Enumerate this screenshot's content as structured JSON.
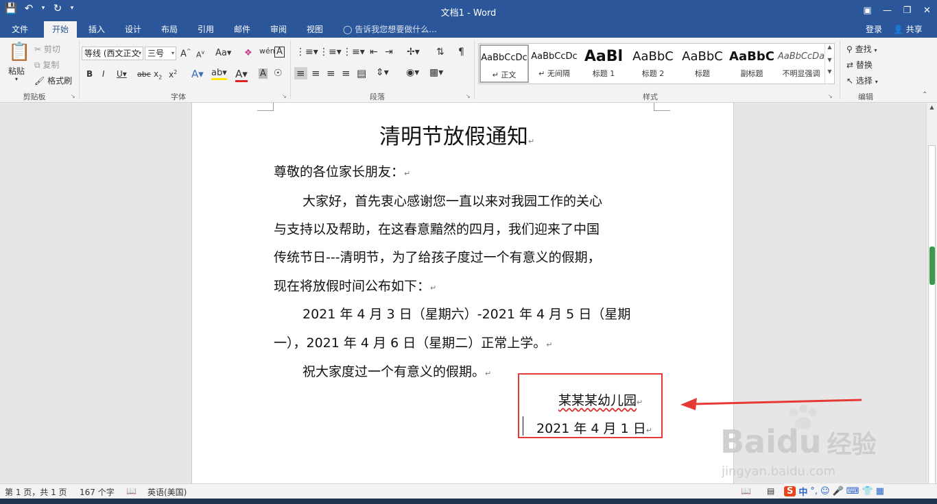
{
  "window": {
    "title": "文档1 - Word"
  },
  "tabs": [
    "文件",
    "开始",
    "插入",
    "设计",
    "布局",
    "引用",
    "邮件",
    "审阅",
    "视图"
  ],
  "tell_me": "告诉我您想要做什么...",
  "account": {
    "signin": "登录",
    "share": "共享"
  },
  "clipboard": {
    "paste": "粘贴",
    "cut": "剪切",
    "copy": "复制",
    "format_painter": "格式刷",
    "group_label": "剪贴板"
  },
  "font": {
    "font_name": "等线 (西文正文",
    "font_size": "三号",
    "group_label": "字体"
  },
  "paragraph": {
    "group_label": "段落"
  },
  "styles": {
    "group_label": "样式",
    "items": [
      {
        "preview": "AaBbCcDc",
        "name": "↵ 正文"
      },
      {
        "preview": "AaBbCcDc",
        "name": "↵ 无间隔"
      },
      {
        "preview": "AaBl",
        "name": "标题 1"
      },
      {
        "preview": "AaBbC",
        "name": "标题 2"
      },
      {
        "preview": "AaBbC",
        "name": "标题"
      },
      {
        "preview": "AaBbC",
        "name": "副标题"
      },
      {
        "preview": "AaBbCcDa",
        "name": "不明显强调"
      }
    ]
  },
  "editing": {
    "find": "查找",
    "replace": "替换",
    "select": "选择",
    "group_label": "编辑"
  },
  "document": {
    "title": "清明节放假通知",
    "greeting": "尊敬的各位家长朋友：",
    "para1": [
      "大家好，首先衷心感谢您一直以来对我园工作的关心",
      "与支持以及帮助，在这春意黯然的四月，我们迎来了中国",
      "传统节日---清明节，为了给孩子度过一个有意义的假期，",
      "现在将放假时间公布如下："
    ],
    "para2": [
      "2021 年 4 月 3 日（星期六）-2021 年 4 月 5 日（星期",
      "一），2021 年 4 月 6 日（星期二）正常上学。"
    ],
    "para3": "祝大家度过一个有意义的假期。",
    "signature": "某某某幼儿园",
    "date": "2021 年 4 月 1 日",
    "para_mark": "↵"
  },
  "status": {
    "page": "第 1 页，共 1 页",
    "words": "167 个字",
    "language": "英语(美国)"
  },
  "ime": {
    "mode": "中"
  },
  "watermark": {
    "brand": "Bai",
    "brand2": "du",
    "cn": "经验",
    "url": "jingyan.baidu.com"
  },
  "colors": {
    "accent": "#2b579a",
    "annotation": "#e53935"
  }
}
